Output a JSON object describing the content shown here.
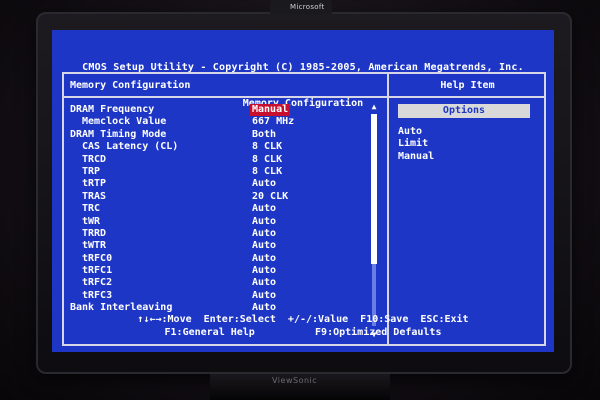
{
  "header": {
    "line1": "CMOS Setup Utility - Copyright (C) 1985-2005, American Megatrends, Inc.",
    "line2": "Memory Configuration"
  },
  "left_panel": {
    "title": "Memory Configuration",
    "rows": [
      {
        "label": "DRAM Frequency",
        "value": "Manual",
        "indent": 0,
        "highlighted": true
      },
      {
        "label": "Memclock Value",
        "value": "667 MHz",
        "indent": 1,
        "highlighted": false
      },
      {
        "label": "DRAM Timing Mode",
        "value": "Both",
        "indent": 0,
        "highlighted": false
      },
      {
        "label": "CAS Latency (CL)",
        "value": "8 CLK",
        "indent": 1,
        "highlighted": false
      },
      {
        "label": "TRCD",
        "value": "8 CLK",
        "indent": 1,
        "highlighted": false
      },
      {
        "label": "TRP",
        "value": "8 CLK",
        "indent": 1,
        "highlighted": false
      },
      {
        "label": "tRTP",
        "value": "Auto",
        "indent": 1,
        "highlighted": false
      },
      {
        "label": "TRAS",
        "value": "20 CLK",
        "indent": 1,
        "highlighted": false
      },
      {
        "label": "TRC",
        "value": "Auto",
        "indent": 1,
        "highlighted": false
      },
      {
        "label": "tWR",
        "value": "Auto",
        "indent": 1,
        "highlighted": false
      },
      {
        "label": "TRRD",
        "value": "Auto",
        "indent": 1,
        "highlighted": false
      },
      {
        "label": "tWTR",
        "value": "Auto",
        "indent": 1,
        "highlighted": false
      },
      {
        "label": "tRFC0",
        "value": "Auto",
        "indent": 1,
        "highlighted": false
      },
      {
        "label": "tRFC1",
        "value": "Auto",
        "indent": 1,
        "highlighted": false
      },
      {
        "label": "tRFC2",
        "value": "Auto",
        "indent": 1,
        "highlighted": false
      },
      {
        "label": "tRFC3",
        "value": "Auto",
        "indent": 1,
        "highlighted": false
      },
      {
        "label": "Bank Interleaving",
        "value": "Auto",
        "indent": 0,
        "highlighted": false
      }
    ]
  },
  "help_panel": {
    "title": "Help Item",
    "options_header": "Options",
    "options": [
      "Auto",
      "Limit",
      "Manual"
    ]
  },
  "footer": {
    "line1": "↑↓←→:Move  Enter:Select  +/-/:Value  F10:Save  ESC:Exit",
    "line2": "F1:General Help          F9:Optimized Defaults"
  },
  "scrollbar": {
    "up": "▲",
    "down": "▼"
  },
  "monitor": {
    "webcam_brand": "Microsoft",
    "brand": "ViewSonic"
  },
  "colors": {
    "screen_bg": "#1d36c6",
    "highlight": "#c8102e",
    "text": "#ffffff",
    "border": "#d6d6e6"
  }
}
